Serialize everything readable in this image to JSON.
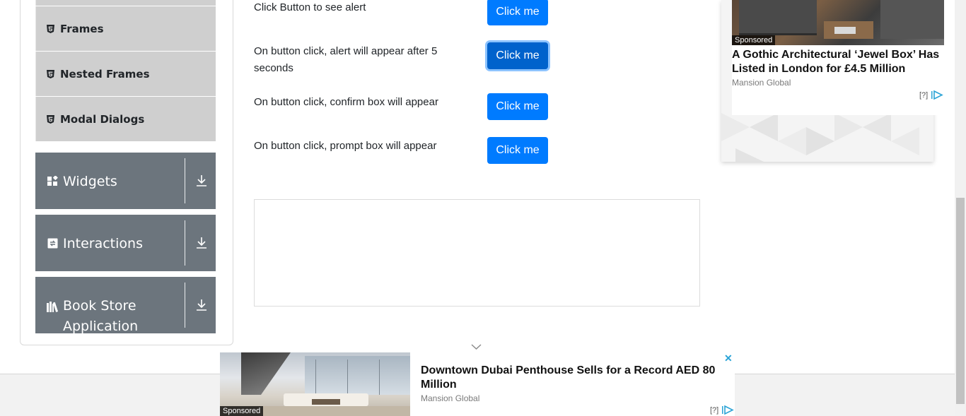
{
  "sidebar": {
    "sub_items": [
      {
        "label": "Frames",
        "icon": "html5-icon"
      },
      {
        "label": "Nested Frames",
        "icon": "html5-icon"
      },
      {
        "label": "Modal Dialogs",
        "icon": "html5-icon"
      }
    ],
    "groups": [
      {
        "label": "Widgets",
        "icon": "widgets-icon"
      },
      {
        "label": "Interactions",
        "icon": "interactions-icon"
      },
      {
        "label": "Book Store Application",
        "icon": "book-store-icon"
      }
    ]
  },
  "alerts": {
    "rows": [
      {
        "text": "Click Button to see alert",
        "button": "Click me"
      },
      {
        "text": "On button click, alert will appear after 5 seconds",
        "button": "Click me"
      },
      {
        "text": "On button click, confirm box will appear",
        "button": "Click me"
      },
      {
        "text": "On button click, prompt box will appear",
        "button": "Click me"
      }
    ]
  },
  "right_ad": {
    "sponsored": "Sponsored",
    "title": "A Gothic Architectural ‘Jewel Box’ Has Listed in London for £4.5 Million",
    "source": "Mansion Global",
    "help": "[?]"
  },
  "bottom_ad": {
    "sponsored": "Sponsored",
    "title": "Downtown Dubai Penthouse Sells for a Record AED 80 Million",
    "source": "Mansion Global",
    "help": "[?]",
    "close": "✕"
  },
  "colors": {
    "primary": "#007bff",
    "group_header": "#6c757d",
    "sub_item": "#cfcfcf"
  }
}
